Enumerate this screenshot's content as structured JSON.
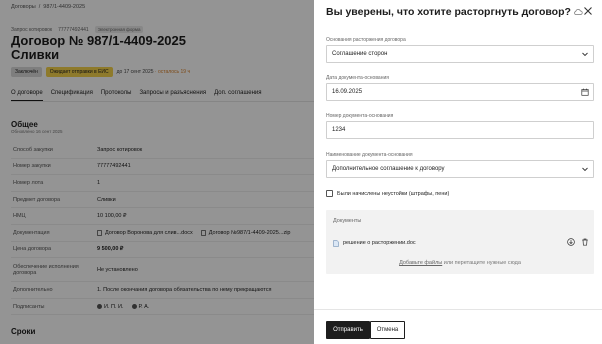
{
  "breadcrumb": {
    "parent": "Договоры",
    "separator": "/",
    "current": "987/1-4409-2025"
  },
  "meta": {
    "procurement": "Запрос котировок",
    "number": "77777492441",
    "form_tag": "Электронная форма"
  },
  "contract": {
    "title": "Договор № 987/1-4409-2025",
    "subtitle": "Сливки"
  },
  "badges": {
    "status": "Заключён",
    "sending": "Ожидает отправки в ЕИС",
    "due_prefix": "до 17 сент 2025",
    "due_suffix": "· осталось 19 ч"
  },
  "tabs": [
    "О договоре",
    "Спецификация",
    "Протоколы",
    "Запросы и разъяснения",
    "Доп. соглашения"
  ],
  "general": {
    "title": "Общее",
    "updated": "Обновлено 16 сент 2025",
    "rows": [
      {
        "key": "Способ закупки",
        "value": "Запрос котировок"
      },
      {
        "key": "Номер закупки",
        "value": "77777492441"
      },
      {
        "key": "Номер лота",
        "value": "1"
      },
      {
        "key": "Предмет договора",
        "value": "Сливки"
      },
      {
        "key": "НМЦ",
        "value": "10 100,00 ₽"
      },
      {
        "key": "Документация",
        "docs": [
          "Договор Воронова для слив...docx",
          "Договор №987/1-4409-2025...zip"
        ]
      },
      {
        "key": "Цена договора",
        "value": "9 500,00 ₽"
      },
      {
        "key": "Обеспечение исполнения договора",
        "value": "Не установлено"
      },
      {
        "key": "Дополнительно",
        "value": "1. После окончания договора обязательства по нему прекращаются"
      },
      {
        "key": "Подписанты",
        "people": [
          "И. П. И.",
          "Р. А."
        ]
      }
    ]
  },
  "terms_title": "Сроки",
  "drawer": {
    "title": "Вы уверены, что хотите расторгнуть договор?",
    "reason_label": "Основания расторжения договора",
    "reason_value": "Соглашение сторон",
    "date_label": "Дата документа-основания",
    "date_value": "16.09.2025",
    "number_label": "Номер документа-основания",
    "number_value": "1234",
    "docname_label": "Наименование документа-основания",
    "docname_value": "Дополнительное соглашение к договору",
    "penalty_label": "Были начислены неустойки (штрафы, пени)",
    "docs_title": "Документы",
    "doc_file": "решение о расторжении.doc",
    "upload_link": "Добавьте файлы",
    "upload_rest": " или перетащите нужные сюда",
    "submit": "Отправить",
    "cancel": "Отмена"
  },
  "colors": {
    "primary": "#1d1d1d",
    "status_yellow": "#f5d24a",
    "warn": "#d9822b",
    "overlay": "rgba(0,0,0,0.42)"
  }
}
